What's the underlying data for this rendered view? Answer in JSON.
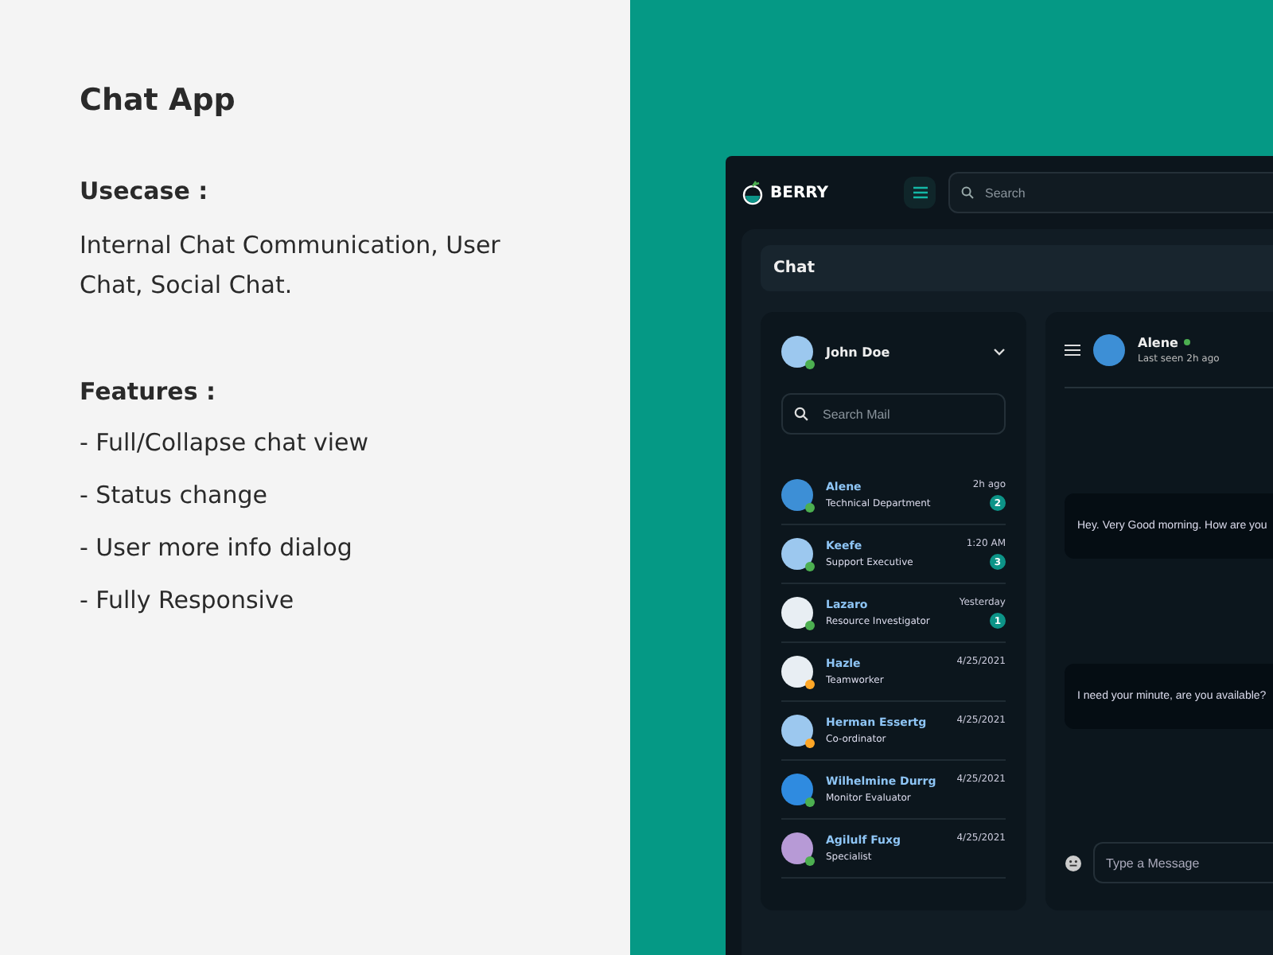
{
  "intro": {
    "title": "Chat App",
    "usecase_heading": "Usecase :",
    "usecase_text": "Internal Chat Communication, User Chat, Social Chat.",
    "features_heading": "Features :",
    "features": [
      "- Full/Collapse chat view",
      "- Status change",
      "- User more info dialog",
      "- Fully Responsive"
    ]
  },
  "app": {
    "brand": "BERRY",
    "search_placeholder": "Search",
    "breadcrumb": "Chat",
    "user": {
      "name": "John Doe",
      "online": true
    },
    "contact_search_placeholder": "Search Mail",
    "contacts": [
      {
        "name": "Alene",
        "role": "Technical Department",
        "time": "2h ago",
        "unread": "2",
        "color": "#4caf50"
      },
      {
        "name": "Keefe",
        "role": "Support Executive",
        "time": "1:20 AM",
        "unread": "3",
        "color": "#4caf50"
      },
      {
        "name": "Lazaro",
        "role": "Resource Investigator",
        "time": "Yesterday",
        "unread": "1",
        "color": "#4caf50"
      },
      {
        "name": "Hazle",
        "role": "Teamworker",
        "time": "4/25/2021",
        "color": "#ffa726"
      },
      {
        "name": "Herman Essertg",
        "role": "Co-ordinator",
        "time": "4/25/2021",
        "color": "#ffa726"
      },
      {
        "name": "Wilhelmine Durrg",
        "role": "Monitor Evaluator",
        "time": "4/25/2021",
        "color": "#4caf50"
      },
      {
        "name": "Agilulf Fuxg",
        "role": "Specialist",
        "time": "4/25/2021",
        "color": "#4caf50"
      }
    ],
    "chat": {
      "name": "Alene",
      "online": true,
      "last_seen": "Last seen 2h ago",
      "messages": [
        "Hey. Very Good morning. How are you",
        "I need your minute, are you available?"
      ],
      "input_placeholder": "Type a Message"
    }
  }
}
